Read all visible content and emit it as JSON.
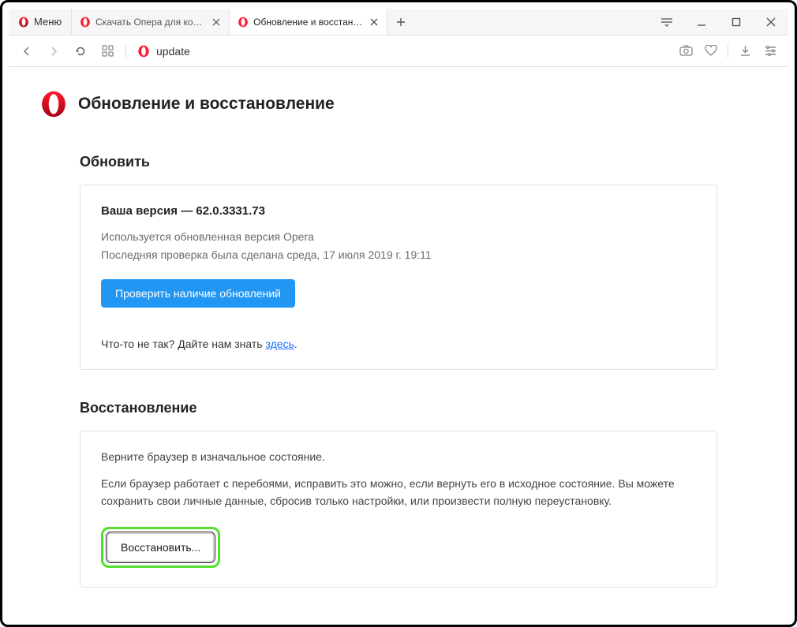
{
  "menu": {
    "label": "Меню"
  },
  "tabs": [
    {
      "label": "Скачать Опера для компь",
      "active": false
    },
    {
      "label": "Обновление и восстановл",
      "active": true
    }
  ],
  "addressbar": {
    "text": "update"
  },
  "page": {
    "title": "Обновление и восстановление",
    "update": {
      "section_title": "Обновить",
      "version_prefix": "Ваша версия — ",
      "version": "62.0.3331.73",
      "status_line": "Используется обновленная версия Opera",
      "last_check": "Последняя проверка была сделана среда, 17 июля 2019 г. 19:11",
      "check_button": "Проверить наличие обновлений",
      "feedback_prefix": "Что-то не так? Дайте нам знать ",
      "feedback_link": "здесь",
      "feedback_suffix": "."
    },
    "restore": {
      "section_title": "Восстановление",
      "lead": "Верните браузер в изначальное состояние.",
      "body": "Если браузер работает с перебоями, исправить это можно, если вернуть его в исходное состояние. Вы можете сохранить свои личные данные, сбросив только настройки, или произвести полную переустановку.",
      "button": "Восстановить..."
    }
  }
}
